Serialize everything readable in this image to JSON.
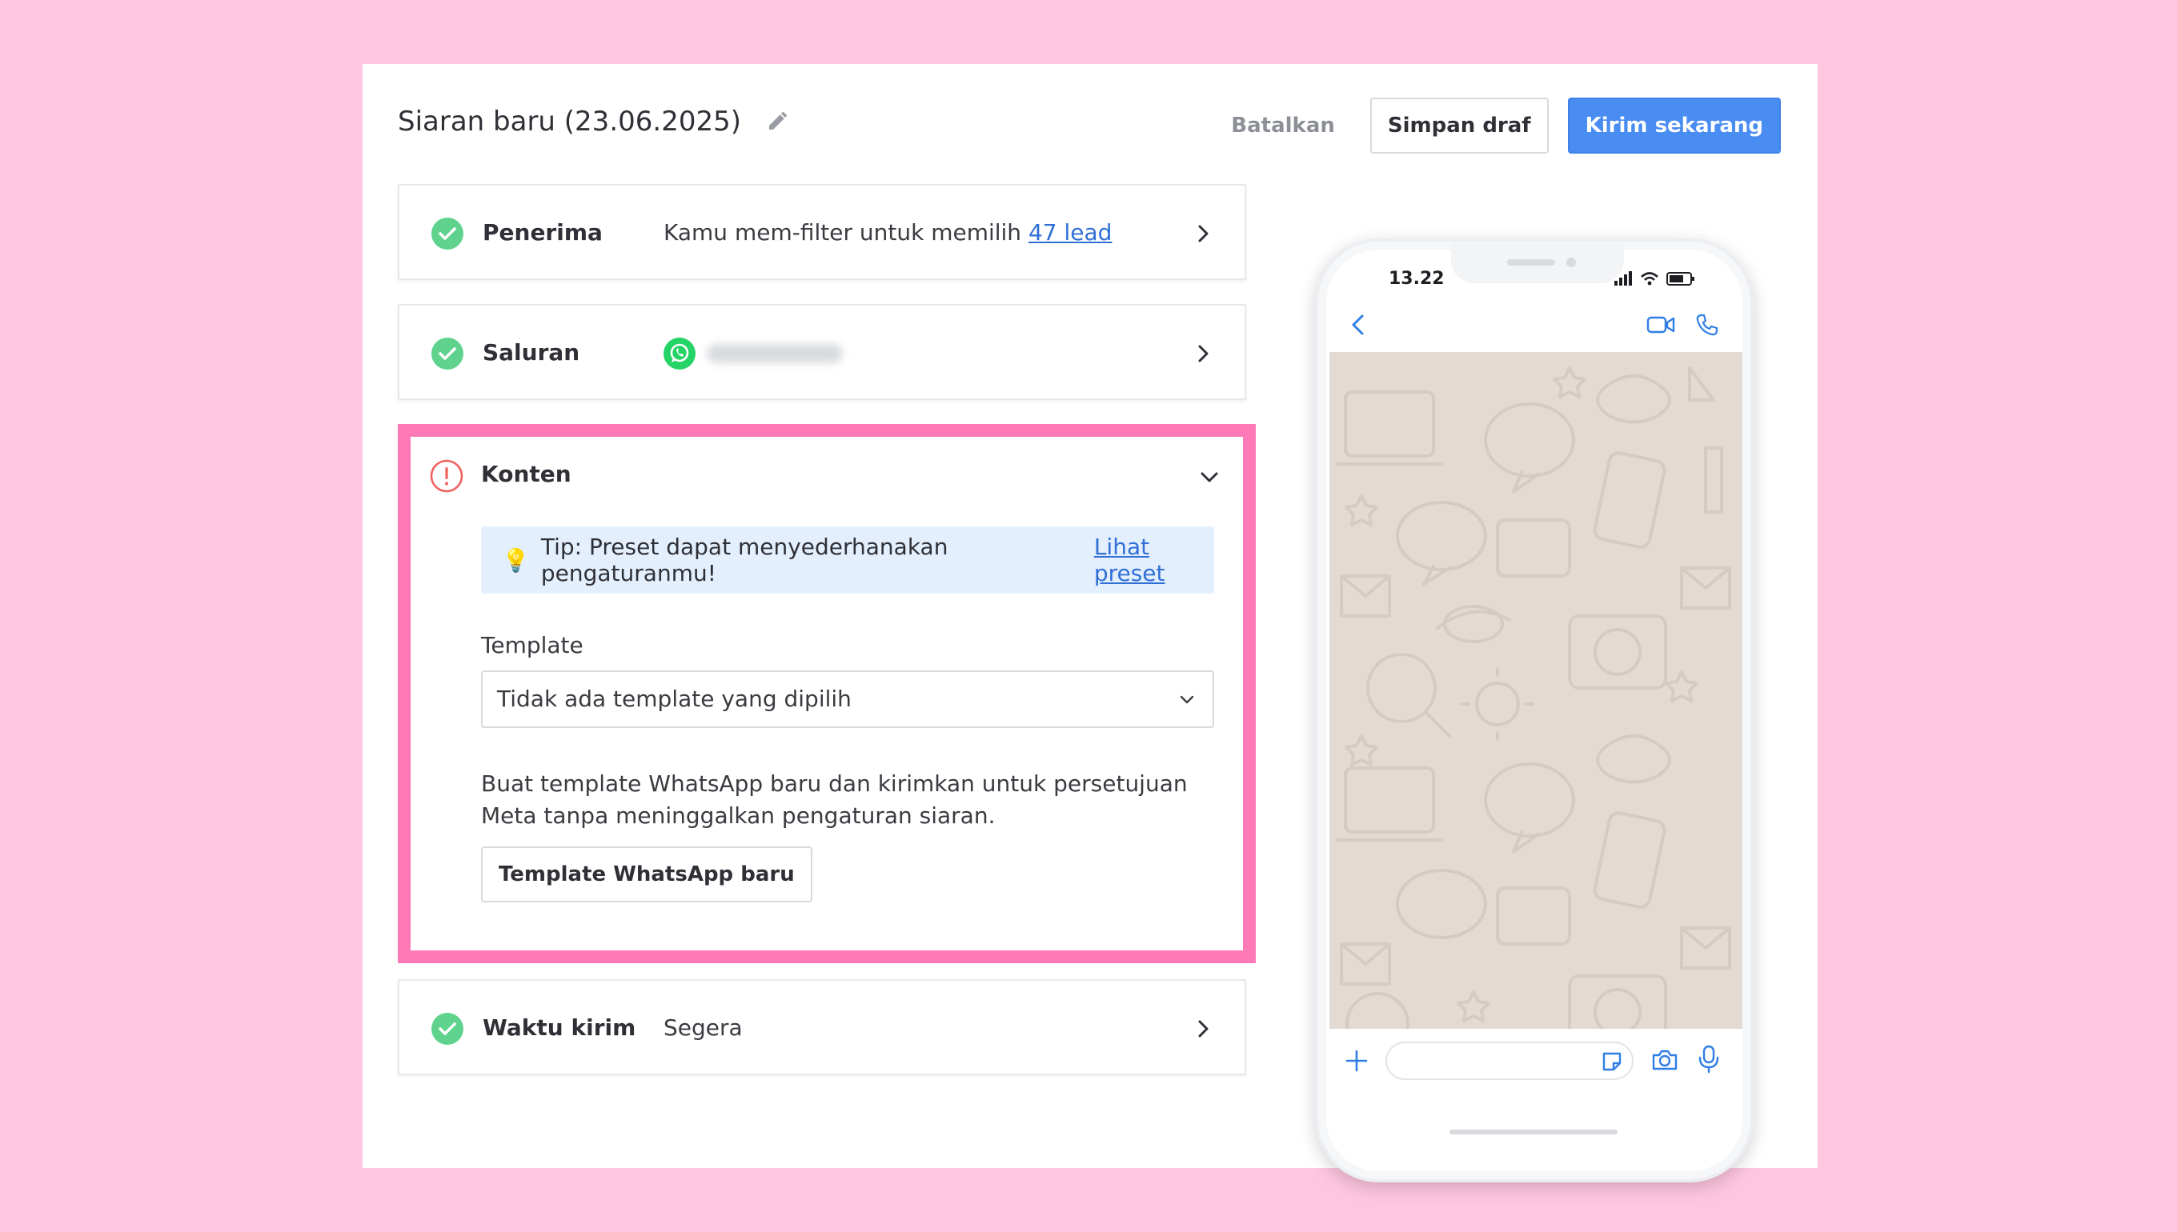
{
  "header": {
    "title": "Siaran baru (23.06.2025)",
    "cancel_label": "Batalkan",
    "save_draft_label": "Simpan draf",
    "send_now_label": "Kirim sekarang"
  },
  "sections": {
    "recipients": {
      "label": "Penerima",
      "value_prefix": "Kamu mem-filter untuk memilih ",
      "value_link": "47 lead"
    },
    "channel": {
      "label": "Saluran"
    },
    "content": {
      "label": "Konten",
      "tip_text": "Tip: Preset dapat menyederhanakan pengaturanmu!",
      "tip_link": "Lihat preset",
      "template_label": "Template",
      "template_value": "Tidak ada template yang dipilih",
      "description": "Buat template WhatsApp baru dan kirimkan untuk persetujuan Meta tanpa meninggalkan pengaturan siaran.",
      "new_template_button": "Template WhatsApp baru"
    },
    "send_time": {
      "label": "Waktu kirim",
      "value": "Segera"
    }
  },
  "phone_preview": {
    "time": "13.22"
  },
  "colors": {
    "background": "#fec6df",
    "highlight_frame": "#fd7ab6",
    "primary": "#4a8df2",
    "success": "#5fd38d",
    "error": "#f0625e",
    "link": "#2f6fd6",
    "tip_bg": "#e4effd",
    "whatsapp": "#25d366"
  },
  "icons": [
    "pencil-icon",
    "check-circle-icon",
    "whatsapp-icon",
    "alert-circle-icon",
    "chevron-right-icon",
    "chevron-down-icon",
    "lightbulb-icon"
  ]
}
